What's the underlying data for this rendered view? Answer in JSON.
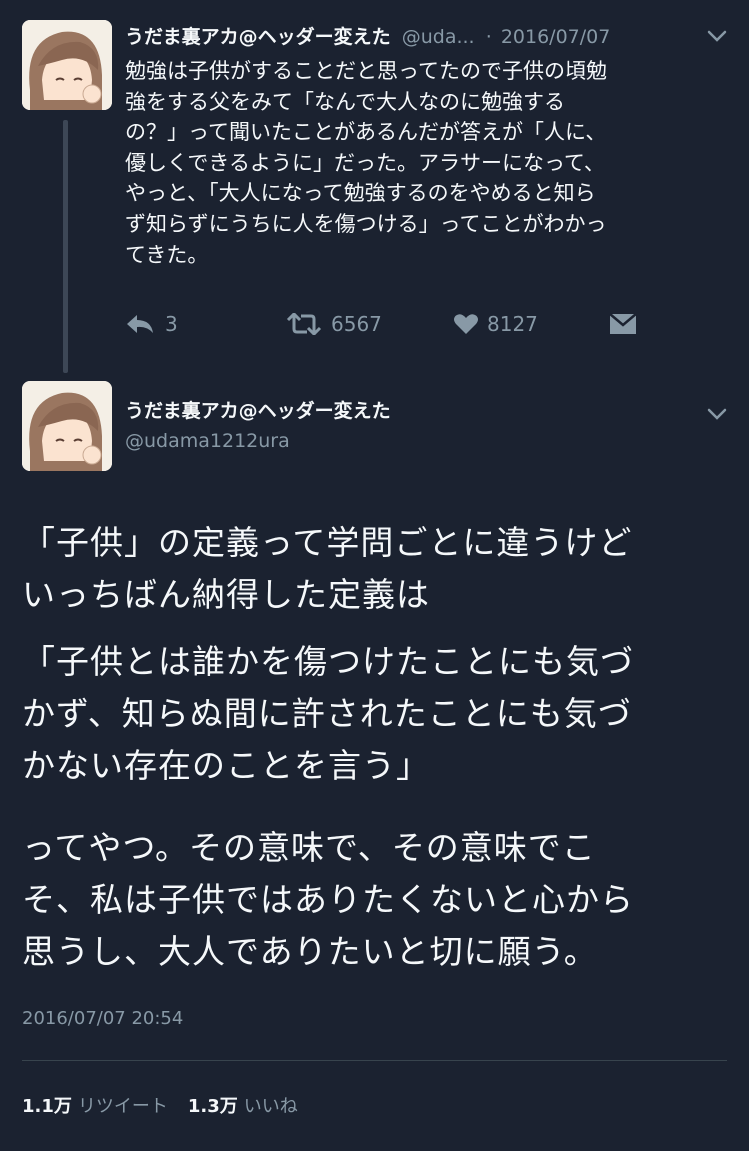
{
  "tweet1": {
    "display_name": "うだま裏アカ@ヘッダー変えた",
    "handle": "@uda...",
    "separator": "·",
    "date": "2016/07/07",
    "text": "勉強は子供がすることだと思ってたので子供の頃勉\n強をする父をみて「なんで大人なのに勉強する\nの？」って聞いたことがあるんだが答えが「人に、\n優しくできるように」だった。アラサーになって、\nやっと、「大人になって勉強するのをやめると知ら\nず知らずにうちに人を傷つける」ってことがわかっ\nてきた。",
    "reply_count": "3",
    "retweet_count": "6567",
    "like_count": "8127"
  },
  "tweet2": {
    "display_name": "うだま裏アカ@ヘッダー変えた",
    "handle": "@udama1212ura",
    "paragraphs": [
      "「子供」の定義って学問ごとに違うけど\nいっちばん納得した定義は",
      "「子供とは誰かを傷つけたことにも気づ\nかず、知らぬ間に許されたことにも気づ\nかない存在のことを言う」",
      "ってやつ。その意味で、その意味でこ\nそ、私は子供ではありたくないと心から\n思うし、大人でありたいと切に願う。"
    ],
    "timestamp": "2016/07/07 20:54",
    "retweets_value": "1.1万",
    "retweets_label": "リツイート",
    "likes_value": "1.3万",
    "likes_label": "いいね"
  },
  "icons": {
    "reply": "reply-icon",
    "retweet": "retweet-icon",
    "like": "heart-icon",
    "dm": "envelope-icon",
    "caret": "chevron-down-icon"
  },
  "colors": {
    "background": "#1b2230",
    "text": "#f5f8fa",
    "muted": "#8899a6"
  }
}
